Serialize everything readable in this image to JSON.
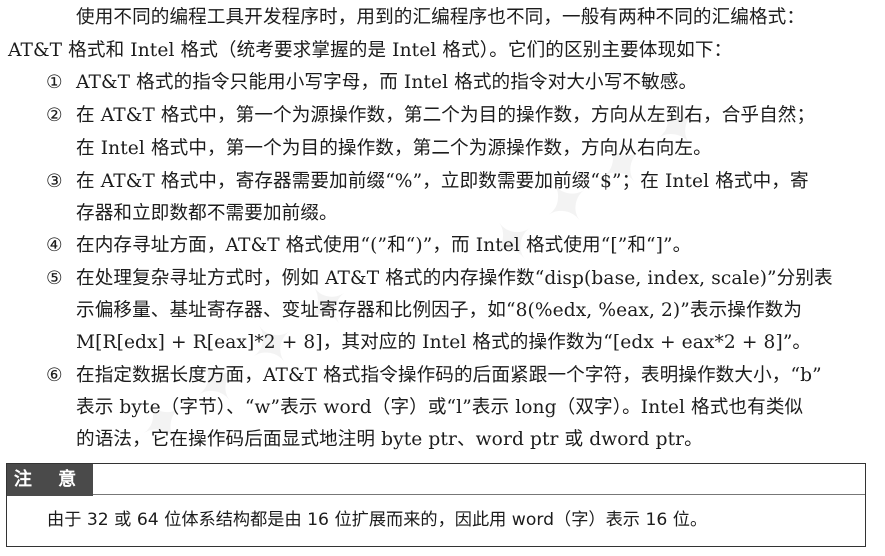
{
  "paragraph": {
    "line1": "使用不同的编程工具开发程序时，用到的汇编程序也不同，一般有两种不同的汇编格式：",
    "line2": "AT&T 格式和 Intel 格式（统考要求掌握的是 Intel 格式）。它们的区别主要体现如下："
  },
  "items": [
    {
      "num": "①",
      "lines": [
        "AT&T 格式的指令只能用小写字母，而 Intel 格式的指令对大小写不敏感。"
      ]
    },
    {
      "num": "②",
      "lines": [
        "在 AT&T 格式中，第一个为源操作数，第二个为目的操作数，方向从左到右，合乎自然；",
        "在 Intel 格式中，第一个为目的操作数，第二个为源操作数，方向从右向左。"
      ]
    },
    {
      "num": "③",
      "lines": [
        "在 AT&T 格式中，寄存器需要加前缀“%”，立即数需要加前缀“$”；在 Intel 格式中，寄",
        "存器和立即数都不需要加前缀。"
      ]
    },
    {
      "num": "④",
      "lines": [
        "在内存寻址方面，AT&T 格式使用“(”和“)”，而 Intel 格式使用“[”和“]”。"
      ]
    },
    {
      "num": "⑤",
      "lines": [
        "在处理复杂寻址方式时，例如 AT&T 格式的内存操作数“disp(base, index, scale)”分别表",
        "示偏移量、基址寄存器、变址寄存器和比例因子，如“8(%edx, %eax, 2)”表示操作数为",
        "M[R[edx] + R[eax]*2 + 8]，其对应的 Intel 格式的操作数为“[edx + eax*2 + 8]”。"
      ]
    },
    {
      "num": "⑥",
      "lines": [
        "在指定数据长度方面，AT&T 格式指令操作码的后面紧跟一个字符，表明操作数大小，“b”",
        "表示 byte（字节）、“w”表示 word（字）或“l”表示 long（双字）。Intel 格式也有类似",
        "的语法，它在操作码后面显式地注明 byte ptr、word ptr 或 dword ptr。"
      ]
    }
  ],
  "note": {
    "label": "注 意",
    "text": "由于 32 或 64 位体系结构都是由 16 位扩展而来的，因此用 word（字）表示 16 位。"
  }
}
